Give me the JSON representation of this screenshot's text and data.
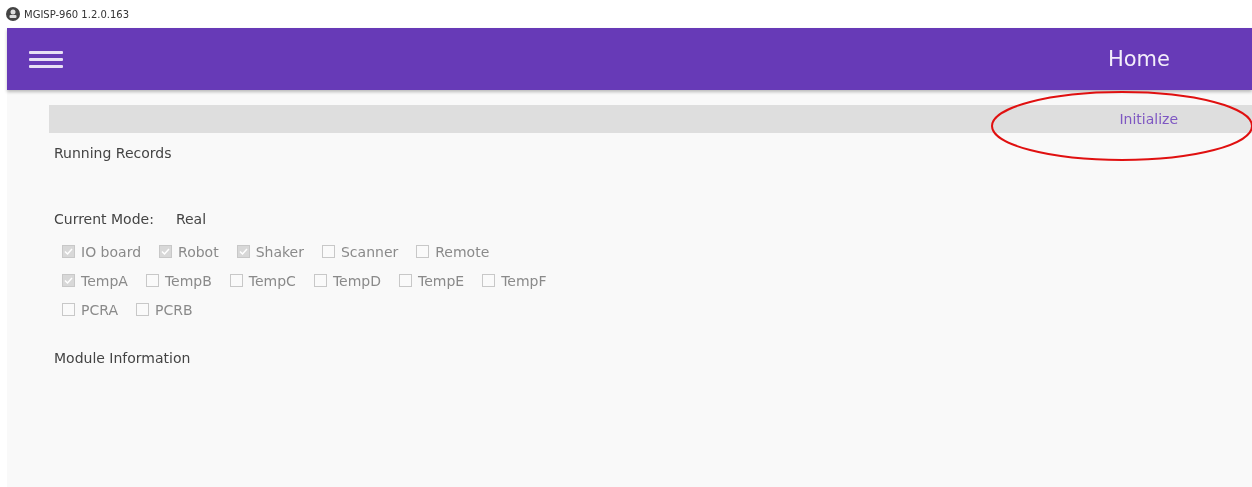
{
  "window": {
    "title": "MGISP-960 1.2.0.163"
  },
  "app_bar": {
    "title": "Home"
  },
  "action_bar": {
    "button": "Initialize"
  },
  "sections": {
    "running_records": "Running Records",
    "mode_label": "Current Mode:",
    "mode_value": "Real",
    "module_information": "Module Information"
  },
  "device_rows": [
    [
      {
        "label": "IO board",
        "checked": true
      },
      {
        "label": "Robot",
        "checked": true
      },
      {
        "label": "Shaker",
        "checked": true
      },
      {
        "label": "Scanner",
        "checked": false
      },
      {
        "label": "Remote",
        "checked": false
      }
    ],
    [
      {
        "label": "TempA",
        "checked": true
      },
      {
        "label": "TempB",
        "checked": false
      },
      {
        "label": "TempC",
        "checked": false
      },
      {
        "label": "TempD",
        "checked": false
      },
      {
        "label": "TempE",
        "checked": false
      },
      {
        "label": "TempF",
        "checked": false
      }
    ],
    [
      {
        "label": "PCRA",
        "checked": false
      },
      {
        "label": "PCRB",
        "checked": false
      }
    ]
  ]
}
